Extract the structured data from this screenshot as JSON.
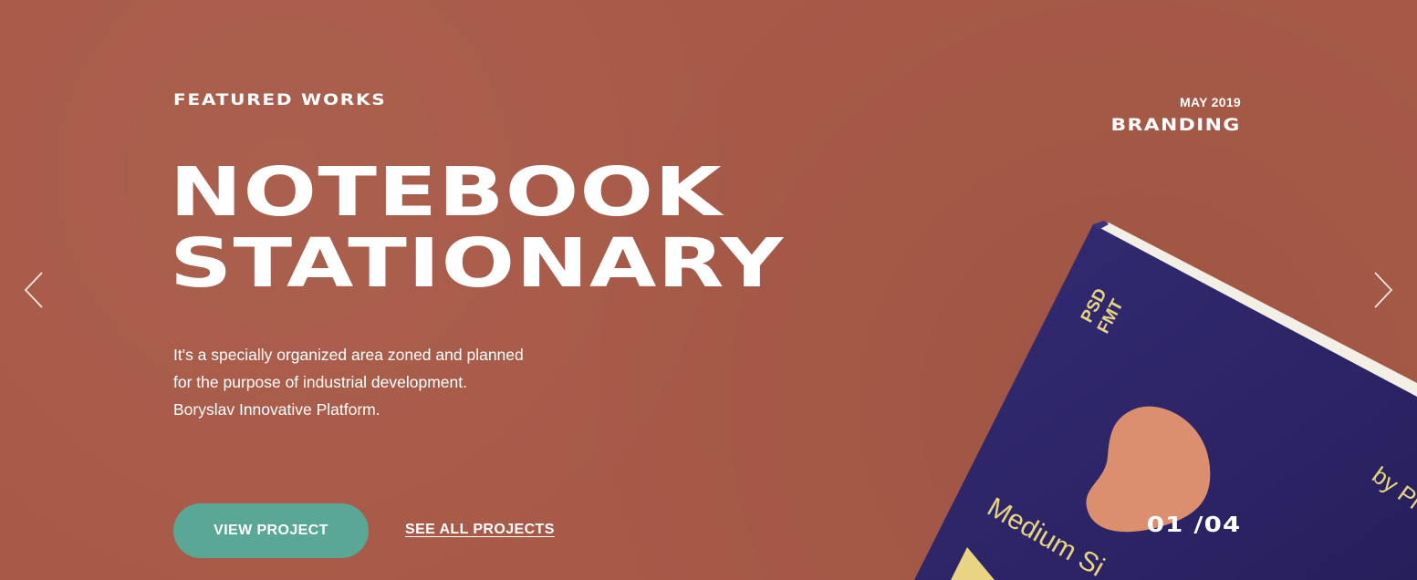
{
  "hero": {
    "section_label": "FEATURED WORKS",
    "date": "MAY 2019",
    "category": "BRANDING",
    "title_line1": "NOTEBOOK",
    "title_line2": "STATIONARY",
    "description": [
      "It's a specially organized area zoned and planned",
      "for the purpose of industrial development.",
      "Boryslav Innovative Platform."
    ],
    "primary_button": "VIEW PROJECT",
    "secondary_link": "SEE ALL PROJECTS",
    "counter": "01 /04"
  },
  "book_cover": {
    "badge_line1": "PSD",
    "badge_line2": "FMT",
    "caption": "Medium Si",
    "signature": "by Pi"
  },
  "icons": {
    "prev": "chevron-left-icon",
    "next": "chevron-right-icon"
  },
  "colors": {
    "background": "#a85a48",
    "button": "#5aa697",
    "book_cover": "#2d2668",
    "book_text": "#e8d483",
    "blob": "#dc8f6f"
  }
}
